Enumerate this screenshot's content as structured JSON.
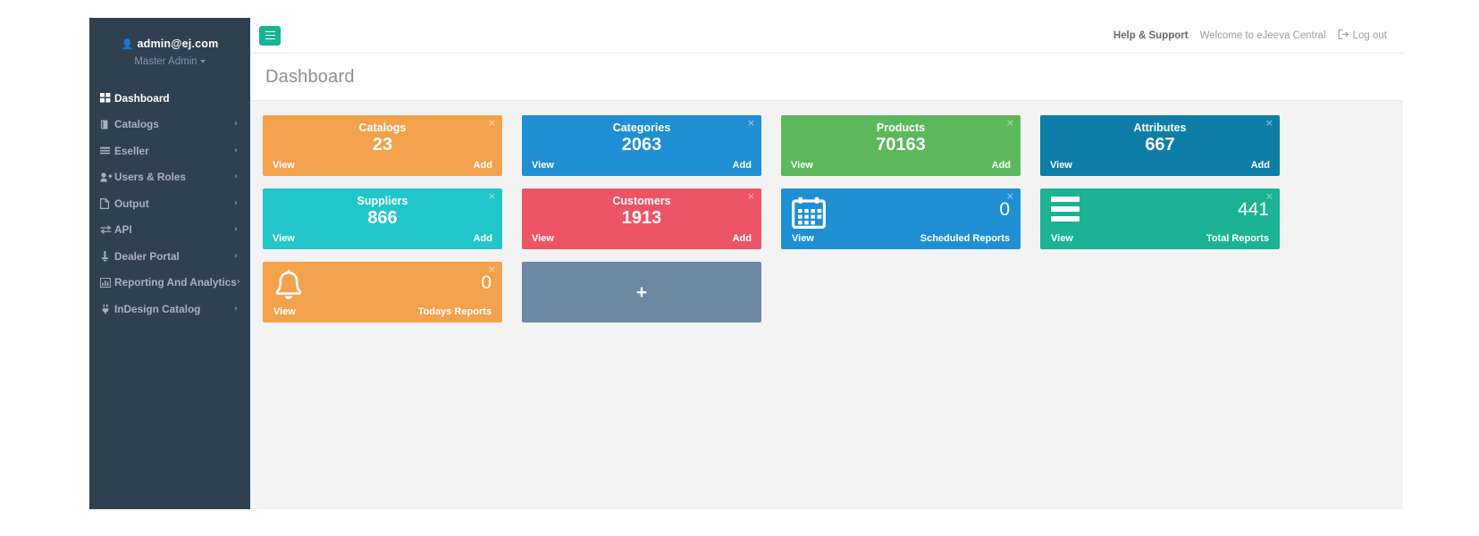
{
  "sidebar": {
    "user_email": "admin@ej.com",
    "user_role": "Master Admin",
    "user_icon": "user-icon",
    "items": [
      {
        "label": "Dashboard",
        "icon": "grid-icon",
        "active": true,
        "arrow": ""
      },
      {
        "label": "Catalogs",
        "icon": "book-icon",
        "active": false,
        "arrow": "›"
      },
      {
        "label": "Eseller",
        "icon": "list-icon",
        "active": false,
        "arrow": "›"
      },
      {
        "label": "Users & Roles",
        "icon": "user-plus-icon",
        "active": false,
        "arrow": "›"
      },
      {
        "label": "Output",
        "icon": "file-icon",
        "active": false,
        "arrow": "›"
      },
      {
        "label": "API",
        "icon": "exchange-icon",
        "active": false,
        "arrow": "›"
      },
      {
        "label": "Dealer Portal",
        "icon": "anchor-icon",
        "active": false,
        "arrow": "›"
      },
      {
        "label": "Reporting And Analytics",
        "icon": "bar-chart-icon",
        "active": false,
        "arrow": "›"
      },
      {
        "label": "InDesign Catalog",
        "icon": "plug-icon",
        "active": false,
        "arrow": "›"
      }
    ]
  },
  "topbar": {
    "menu_toggle_icon": "hamburger-icon",
    "help_label": "Help & Support",
    "welcome_text": "Welcome to eJeeva Central",
    "logout_label": "Log out",
    "logout_icon": "sign-out-icon"
  },
  "page": {
    "title": "Dashboard"
  },
  "tiles": {
    "close_glyph": "×",
    "row1": [
      {
        "title": "Catalogs",
        "count": "23",
        "view": "View",
        "add": "Add",
        "color": "#f4a14d"
      },
      {
        "title": "Categories",
        "count": "2063",
        "view": "View",
        "add": "Add",
        "color": "#1f8fd4"
      },
      {
        "title": "Products",
        "count": "70163",
        "view": "View",
        "add": "Add",
        "color": "#5cb85c"
      },
      {
        "title": "Attributes",
        "count": "667",
        "view": "View",
        "add": "Add",
        "color": "#0d7ea8"
      }
    ],
    "row2": [
      {
        "title": "Suppliers",
        "count": "866",
        "view": "View",
        "add": "Add",
        "color": "#23c6c8"
      },
      {
        "title": "Customers",
        "count": "1913",
        "view": "View",
        "add": "Add",
        "color": "#ed5565"
      }
    ],
    "scheduled": {
      "count": "0",
      "label": "Scheduled Reports",
      "view": "View",
      "icon": "calendar-icon",
      "color": "#1f8fd4"
    },
    "total": {
      "count": "441",
      "label": "Total Reports",
      "view": "View",
      "icon": "bars-icon",
      "color": "#1ab394"
    },
    "today": {
      "count": "0",
      "label": "Todays Reports",
      "view": "View",
      "icon": "bell-icon",
      "color": "#f4a14d"
    },
    "add_tile": {
      "label": "+",
      "color": "#6e87a2"
    }
  }
}
